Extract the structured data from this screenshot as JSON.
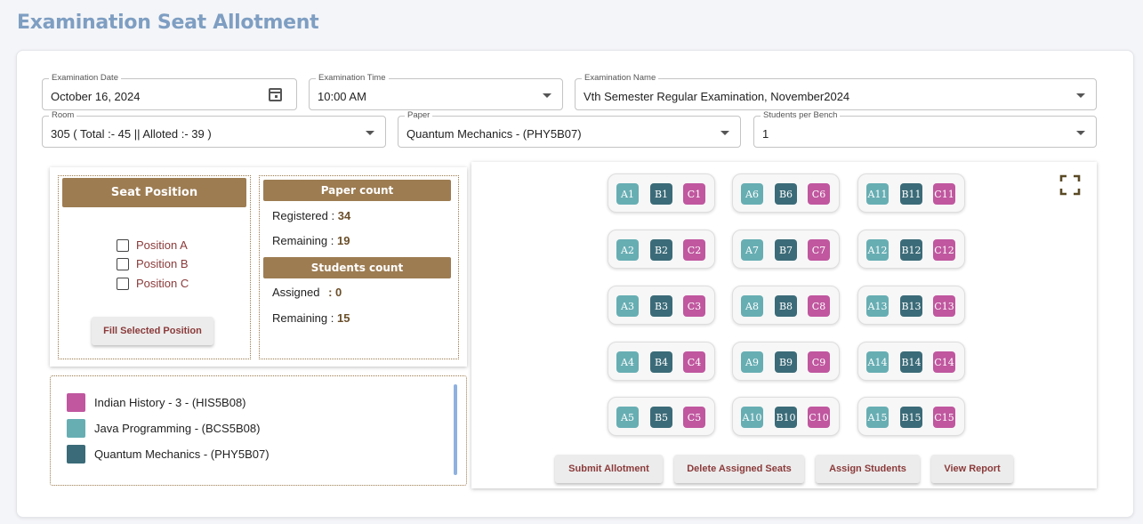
{
  "page": {
    "title": "Examination Seat Allotment"
  },
  "filters": {
    "exam_date": {
      "label": "Examination Date",
      "value": "October 16, 2024"
    },
    "exam_time": {
      "label": "Examination Time",
      "value": "10:00 AM"
    },
    "exam_name": {
      "label": "Examination Name",
      "value": "Vth Semester Regular Examination, November2024"
    },
    "room": {
      "label": "Room",
      "value": "305 ( Total :- 45 || Alloted :- 39 )"
    },
    "paper": {
      "label": "Paper",
      "value": "Quantum Mechanics - (PHY5B07)"
    },
    "students_per_bench": {
      "label": "Students per Bench",
      "value": "1"
    }
  },
  "seat_position": {
    "title": "Seat Position",
    "options": [
      "Position A",
      "Position B",
      "Position C"
    ],
    "fill_button": "Fill Selected Position"
  },
  "paper_count": {
    "title": "Paper count",
    "registered_label": "Registered :",
    "registered": "34",
    "remaining_label": "Remaining :",
    "remaining": "19"
  },
  "students_count": {
    "title": "Students count",
    "assigned_label": "Assigned",
    "assigned": ": 0",
    "remaining_label": "Remaining :",
    "remaining": "15"
  },
  "legend": [
    {
      "label": "Indian History - 3 - (HIS5B08)",
      "color": "#c0579f"
    },
    {
      "label": "Java Programming - (BCS5B08)",
      "color": "#67aeb3"
    },
    {
      "label": "Quantum Mechanics - (PHY5B07)",
      "color": "#3b6b78"
    }
  ],
  "seat_colors": {
    "A": "#67aeb3",
    "B": "#3b6b78",
    "C": "#c0579f"
  },
  "benches": [
    [
      "A1",
      "B1",
      "C1"
    ],
    [
      "A6",
      "B6",
      "C6"
    ],
    [
      "A11",
      "B11",
      "C11"
    ],
    [
      "A2",
      "B2",
      "C2"
    ],
    [
      "A7",
      "B7",
      "C7"
    ],
    [
      "A12",
      "B12",
      "C12"
    ],
    [
      "A3",
      "B3",
      "C3"
    ],
    [
      "A8",
      "B8",
      "C8"
    ],
    [
      "A13",
      "B13",
      "C13"
    ],
    [
      "A4",
      "B4",
      "C4"
    ],
    [
      "A9",
      "B9",
      "C9"
    ],
    [
      "A14",
      "B14",
      "C14"
    ],
    [
      "A5",
      "B5",
      "C5"
    ],
    [
      "A10",
      "B10",
      "C10"
    ],
    [
      "A15",
      "B15",
      "C15"
    ]
  ],
  "actions": {
    "submit": "Submit Allotment",
    "delete": "Delete Assigned Seats",
    "assign": "Assign Students",
    "report": "View Report"
  },
  "icons": {
    "fullscreen": "fullscreen-icon",
    "calendar": "calendar-icon"
  }
}
